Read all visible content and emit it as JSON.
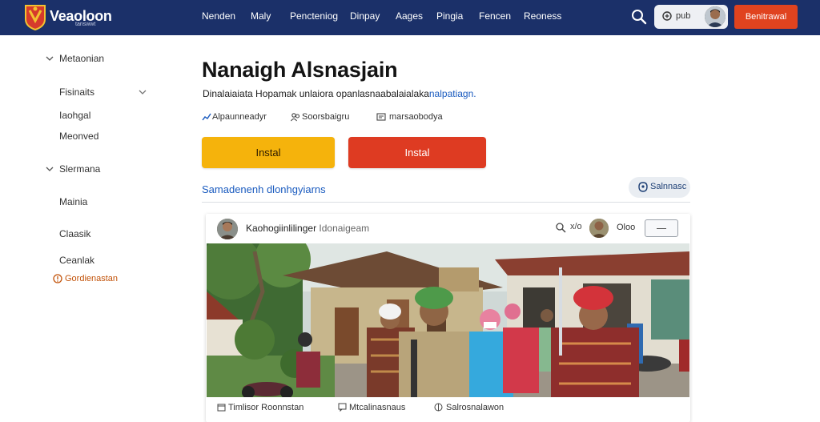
{
  "header": {
    "brand": "Veaoloon",
    "brand_sub": "tanswwt",
    "nav": [
      "Nenden",
      "Maly",
      "Pencteniog",
      "Dinpay",
      "Aages",
      "Pingia",
      "Fencen",
      "Reoness"
    ],
    "account_label": "pub",
    "cta_label": "Benitrawal",
    "colors": {
      "bar": "#1b3069",
      "cta": "#e0431f"
    }
  },
  "sidebar": {
    "groups": [
      {
        "label": "Metaonian",
        "expanded": true
      },
      {
        "label": "Slermana",
        "expanded": true
      }
    ],
    "items": [
      "Fisinaits",
      "Iaohgal",
      "Meonved",
      "Mainia",
      "Claasik",
      "Ceanlak"
    ],
    "warning_label": "Gordienastan"
  },
  "main": {
    "title": "Nanaigh Alsnasjain",
    "description": "Dinalaiaiata Hopamak unlaiora opanlasnaabalaialaka",
    "description_link": "nalpatiagn.",
    "meta": [
      "Alpaunneadyr",
      "Soorsbaigru",
      "marsaobodya"
    ],
    "buttons": {
      "primary": "Instal",
      "secondary": "Instal"
    },
    "link_row": "Samadenenh dlonhgyiarns",
    "pill_label": "Salnnasc",
    "colors": {
      "yellow": "#f5b30c",
      "red": "#de3b22",
      "link": "#1a5bbf"
    }
  },
  "post": {
    "author": "Kaohogiinlilinger",
    "author_sub": "Idonaigeam",
    "close_label": "x/o",
    "count_label": "Oloo",
    "footer": [
      "Timlisor Roonnstan",
      "Mtcalinasnaus",
      "Salrosnalawon"
    ]
  }
}
